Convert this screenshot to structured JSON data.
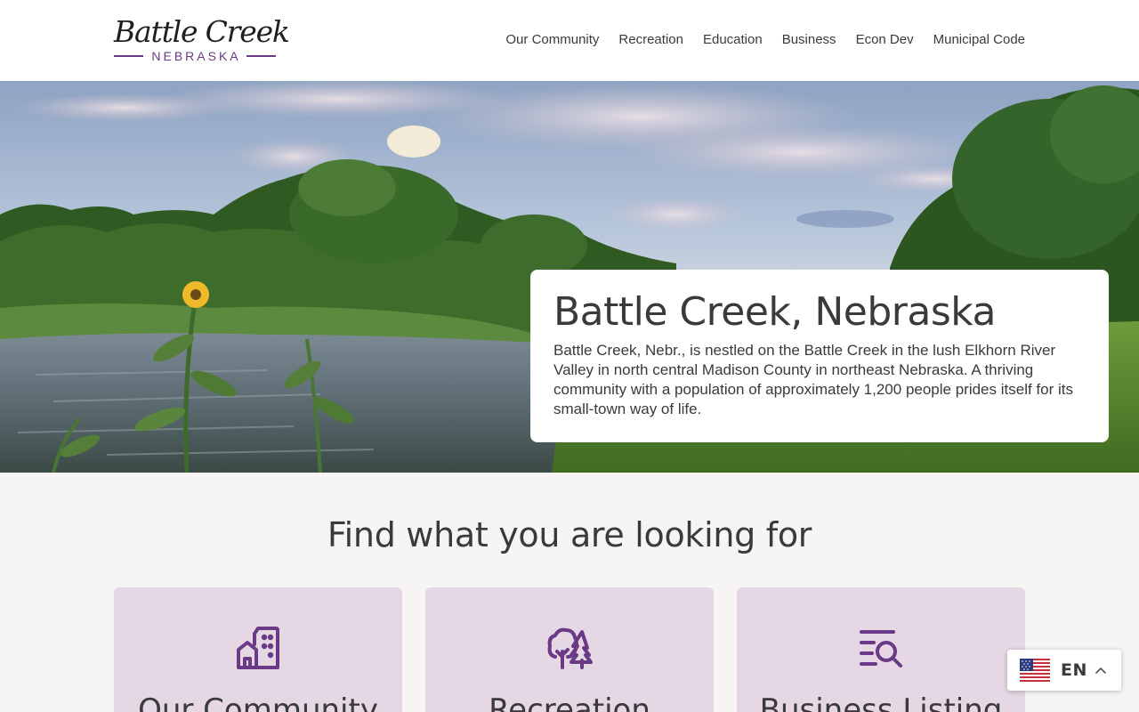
{
  "header": {
    "logo": {
      "script_text": "Battle Creek",
      "sub_text": "NEBRASKA"
    },
    "nav": [
      {
        "label": "Our Community"
      },
      {
        "label": "Recreation"
      },
      {
        "label": "Education"
      },
      {
        "label": "Business"
      },
      {
        "label": "Econ Dev"
      },
      {
        "label": "Municipal Code"
      }
    ]
  },
  "hero": {
    "image_icon": "river-landscape-photo",
    "title": "Battle Creek, Nebraska",
    "description": "Battle Creek, Nebr., is nestled on the Battle Creek in the lush Elkhorn River Valley in north central Madison County in northeast Nebraska. A thriving community with a population of approximately 1,200 people prides itself for its small-town way of life."
  },
  "finder": {
    "title": "Find what you are looking for",
    "cards": [
      {
        "label": "Our Community",
        "icon": "city-buildings-icon"
      },
      {
        "label": "Recreation",
        "icon": "trees-icon"
      },
      {
        "label": "Business Listing",
        "icon": "list-search-icon"
      }
    ]
  },
  "language": {
    "code": "EN",
    "flag_icon": "us-flag-icon"
  },
  "colors": {
    "brand_purple": "#6b3a86",
    "card_background": "#e5d7e3",
    "page_background": "#f7f5f4",
    "text": "#3a3a3a"
  }
}
